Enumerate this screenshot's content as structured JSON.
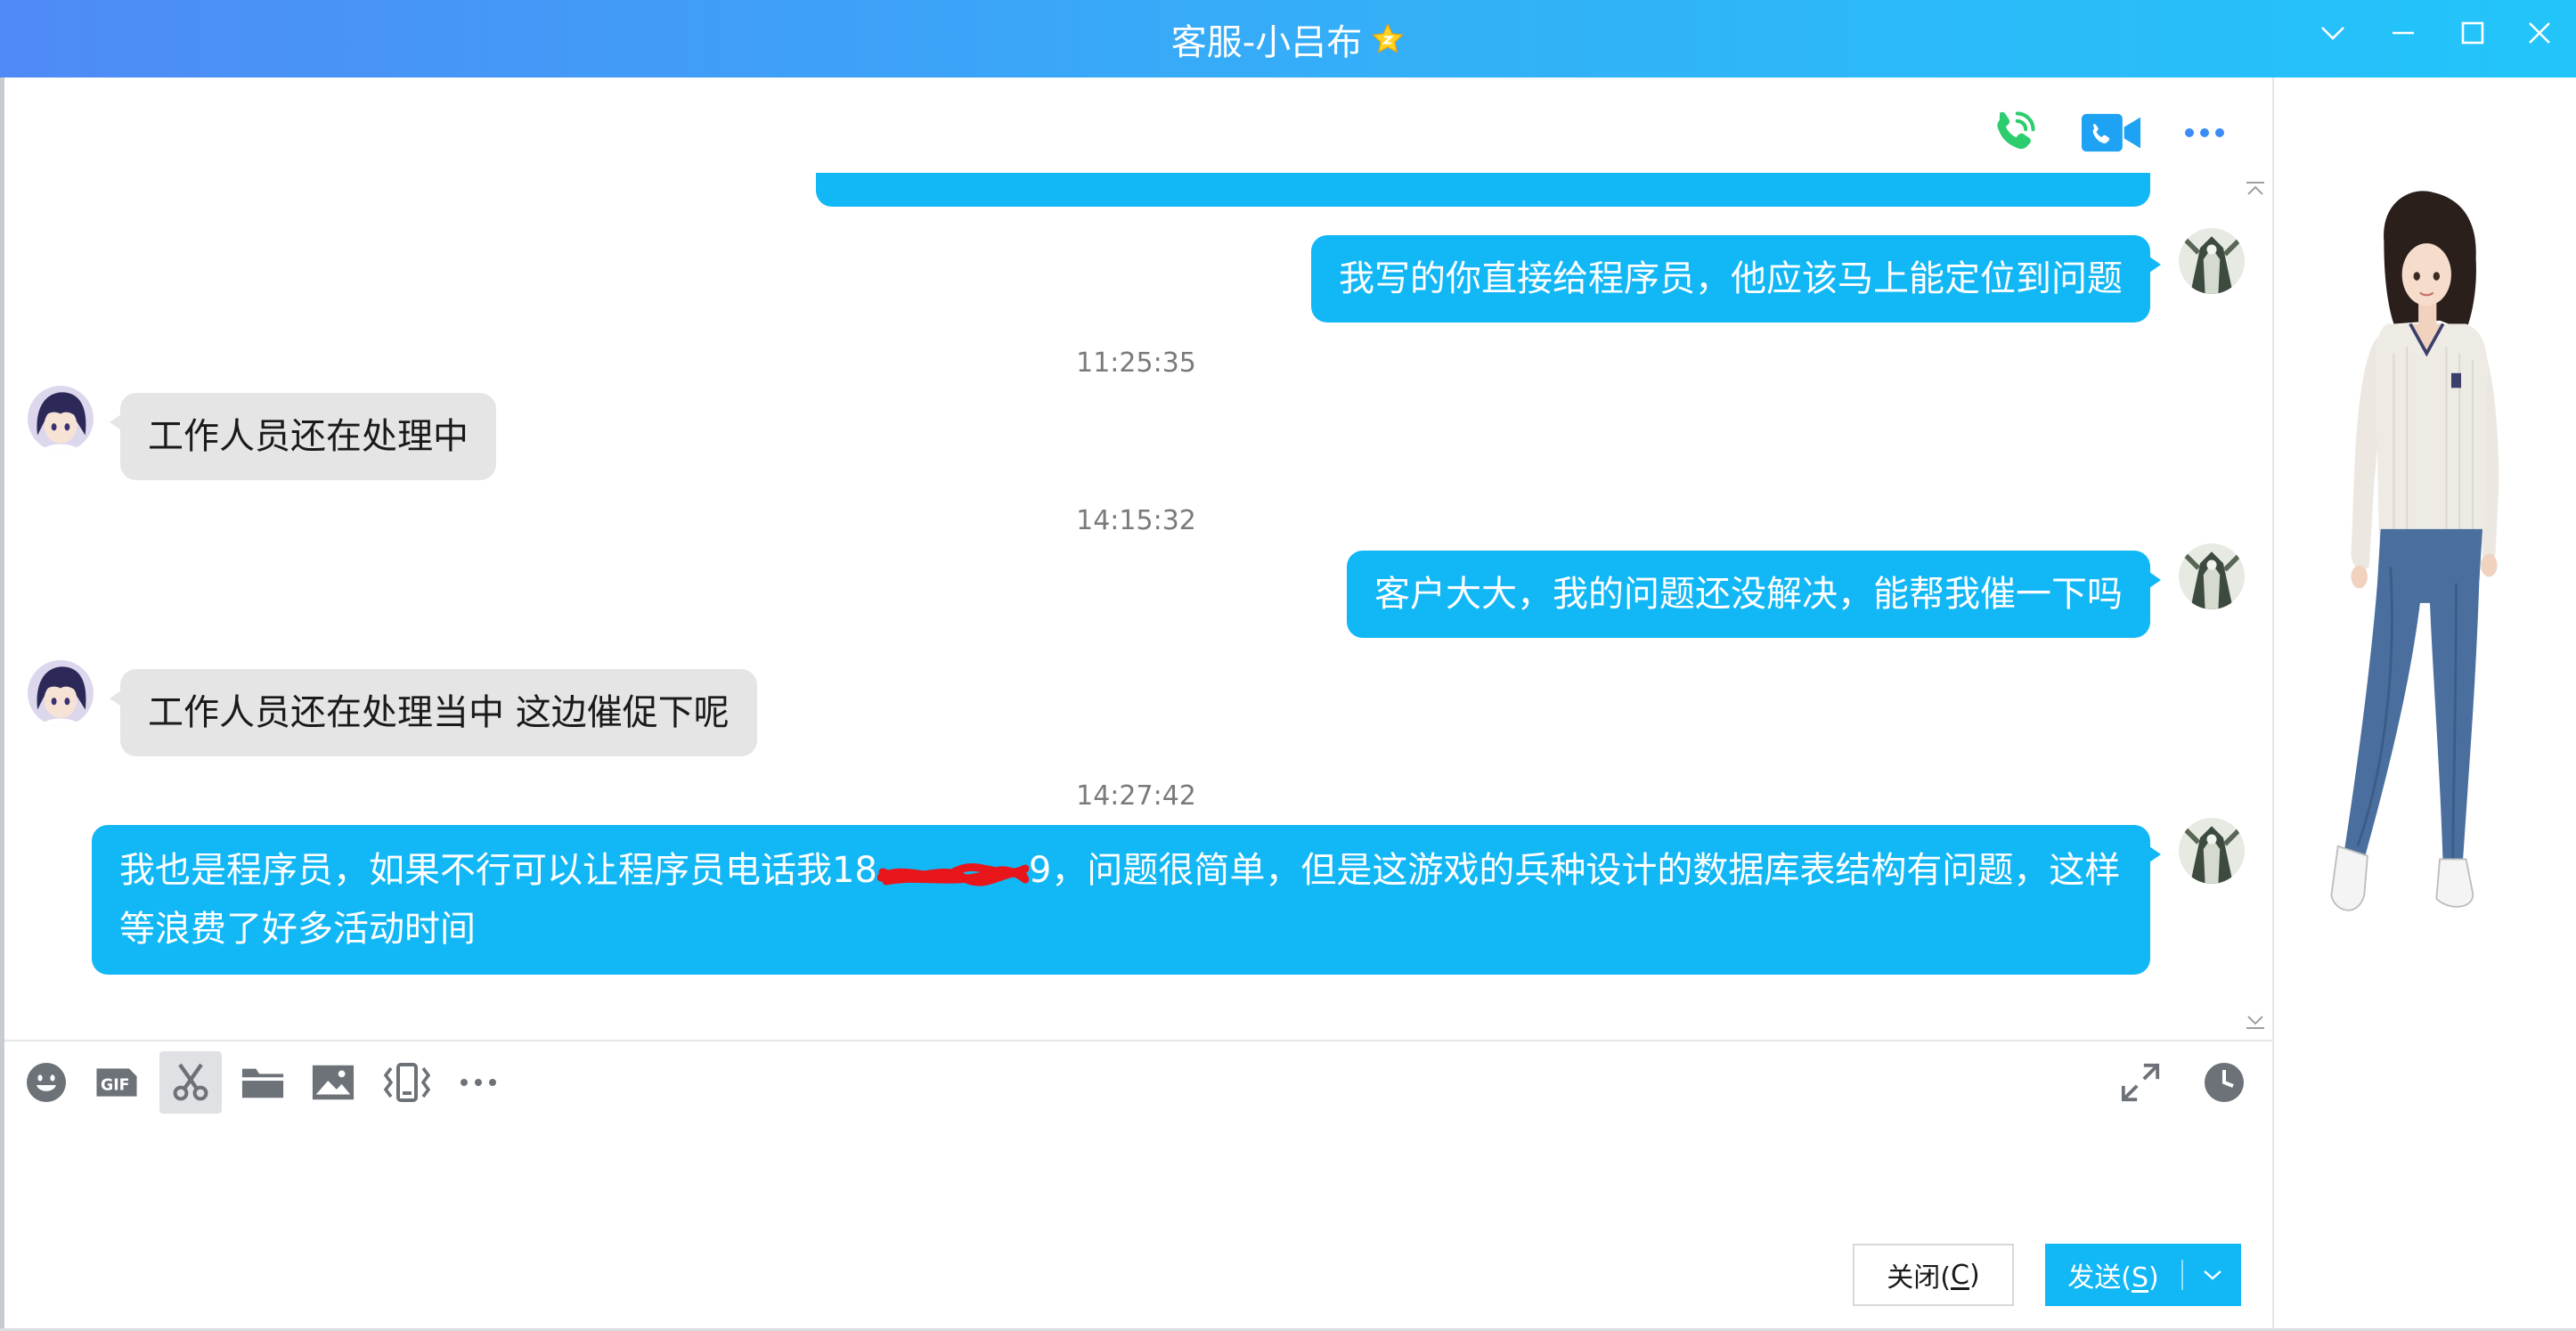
{
  "window": {
    "title": "客服-小吕布",
    "title_badge_icon": "vip-star-icon",
    "controls": {
      "collapse_icon": "chevron-down-icon",
      "minimize_icon": "minimize-icon",
      "maximize_icon": "maximize-icon",
      "close_icon": "close-icon"
    }
  },
  "header_actions": {
    "voice_call_icon": "phone-call-icon",
    "video_call_icon": "video-call-icon",
    "more_icon": "more-icon"
  },
  "chat": {
    "messages": [
      {
        "avatar": "user-avatar",
        "text": "我写的你直接给程序员，他应该马上能定位到问题"
      },
      {
        "time": "11:25:35"
      },
      {
        "avatar": "agent-avatar",
        "text": "工作人员还在处理中"
      },
      {
        "time": "14:15:32"
      },
      {
        "avatar": "user-avatar",
        "text": "客户大大，我的问题还没解决，能帮我催一下吗"
      },
      {
        "avatar": "agent-avatar",
        "text": "工作人员还在处理当中 这边催促下呢"
      },
      {
        "time": "14:27:42"
      },
      {
        "avatar": "user-avatar",
        "text_before_redaction": "我也是程序员，如果不行可以让程序员电话我18",
        "text_after_redaction": "9，问题很简单，但是这游戏的兵种设计的数据库表结构有问题，这样",
        "text_line_2": "等浪费了好多活动时间"
      }
    ]
  },
  "toolbar": {
    "icons": [
      "emoji-icon",
      "gif-icon",
      "scissors-icon",
      "folder-icon",
      "image-icon",
      "window-shake-icon",
      "more-icon",
      "expand-icon",
      "clock-icon"
    ],
    "gif_label": "GIF"
  },
  "input": {
    "value": ""
  },
  "buttons": {
    "close": {
      "label": "关闭(",
      "hotkey": "C",
      "suffix": ")"
    },
    "send": {
      "label": "发送(",
      "hotkey": "S",
      "suffix": ")",
      "dropdown_icon": "chevron-down-icon"
    }
  },
  "side_panel": {
    "illustration": "girl-character-show-image"
  },
  "colors": {
    "accent": "#12b7f5",
    "received_bubble": "#e5e5e5",
    "timestamp": "#7a7a7a",
    "title_gradient_start": "#4f8af6",
    "title_gradient_end": "#22c5fa",
    "call_green": "#2ccd6e"
  }
}
